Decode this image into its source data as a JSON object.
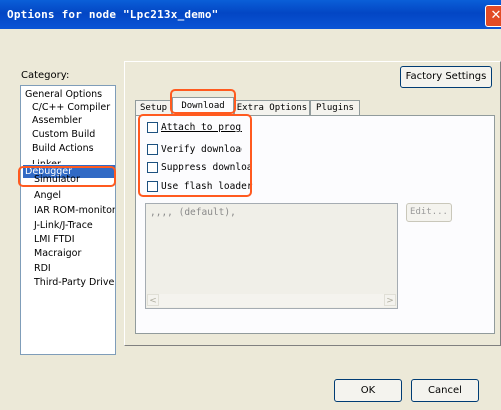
{
  "window": {
    "title": "Options for node \"Lpc213x_demo\"",
    "close_glyph": "✕"
  },
  "category": {
    "label": "Category:",
    "items": [
      {
        "label": "General Options",
        "level": 0
      },
      {
        "label": "C/C++ Compiler",
        "level": 1
      },
      {
        "label": "Assembler",
        "level": 1
      },
      {
        "label": "Custom Build",
        "level": 1
      },
      {
        "label": "Build Actions",
        "level": 1
      },
      {
        "label": "Linker",
        "level": 1
      },
      {
        "label": "Debugger",
        "level": 1,
        "selected": true
      },
      {
        "label": "Simulator",
        "level": 2
      },
      {
        "label": "Angel",
        "level": 2
      },
      {
        "label": "IAR ROM-monitor",
        "level": 2
      },
      {
        "label": "J-Link/J-Trace",
        "level": 2
      },
      {
        "label": "LMI FTDI",
        "level": 2
      },
      {
        "label": "Macraigor",
        "level": 2
      },
      {
        "label": "RDI",
        "level": 2
      },
      {
        "label": "Third-Party Driver",
        "level": 2
      }
    ]
  },
  "factory_settings": "Factory Settings",
  "tabs": [
    {
      "label": "Setup"
    },
    {
      "label": "Download",
      "active": true
    },
    {
      "label": "Extra Options"
    },
    {
      "label": "Plugins"
    }
  ],
  "download": {
    "options": [
      {
        "label": "Attach to progr",
        "checked": false
      },
      {
        "label": "Verify download",
        "checked": false
      },
      {
        "label": "Suppress downloac",
        "checked": false
      },
      {
        "label": "Use flash loader",
        "checked": false
      }
    ],
    "flash_args": ",,,, (default),",
    "edit_button": "Edit..."
  },
  "buttons": {
    "ok": "OK",
    "cancel": "Cancel"
  },
  "colors": {
    "highlight": "#ff5a1f",
    "selection": "#316ac5",
    "titlebar": "#0a54d6"
  }
}
